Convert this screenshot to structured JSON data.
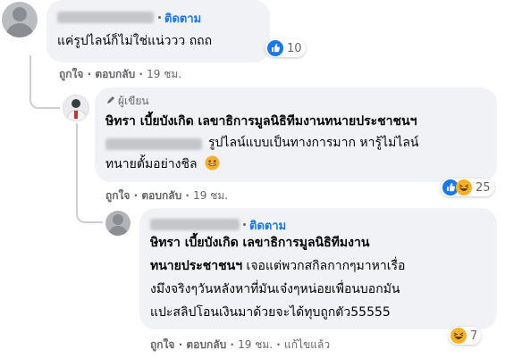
{
  "comments": [
    {
      "follow_label": "ติดตาม",
      "text_line1": "แค่รูปไลน์ก็ไม่ใช่แน่ววว ถถถ",
      "reaction_count": "10",
      "actions": {
        "like": "ถูกใจ",
        "reply": "ตอบกลับ",
        "time": "19 ชม."
      }
    },
    {
      "author_badge": "ผู้เขียน",
      "mention_line": "ษิทรา เบี้ยบังเกิด เลขาธิการมูลนิธิทีมงานทนายประชาชนฯ",
      "text_line2": "รูปไลน์แบบเป็นทางการมาก หารู้ไม่ไลน์",
      "text_line3": "ทนายตั้มอย่างชิล",
      "reaction_count": "25",
      "actions": {
        "like": "ถูกใจ",
        "reply": "ตอบกลับ",
        "time": "19 ชม."
      }
    },
    {
      "follow_label": "ติดตาม",
      "mention_line1": "ษิทรา เบี้ยบังเกิด เลขาธิการมูลนิธิทีมงาน",
      "mention_line2": "ทนายประชาชนฯ",
      "text_line2_rest": "เจอแต่พวกสกิลกากๆมาหาเรื่อ",
      "text_line3": "งมึงจริงๆวันหลังหาที่มันเจ๋งๆหน่อยเพื่อนบอกมัน",
      "text_line4": "แปะสลิปโอนเงินมาด้วยจะได้ทุบถูกตัว55555",
      "reaction_count": "7",
      "actions": {
        "like": "ถูกใจ",
        "reply": "ตอบกลับ",
        "time": "19 ชม.",
        "edited": "แก้ไขแล้ว"
      }
    }
  ],
  "icons": [
    "like-reaction-icon",
    "haha-reaction-icon",
    "pencil-icon"
  ],
  "colors": {
    "link": "#1877f2",
    "bubble": "#f0f2f5",
    "meta": "#65676b",
    "like": "#1877f2",
    "haha": "#f7b125"
  }
}
